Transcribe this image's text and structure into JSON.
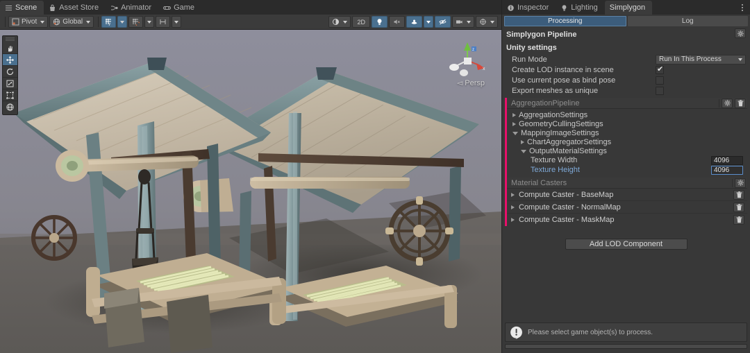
{
  "editor": {
    "scene_tabs": [
      {
        "label": "Scene",
        "icon": "scene-grid-icon",
        "active": true
      },
      {
        "label": "Asset Store",
        "icon": "store-bag-icon",
        "active": false
      },
      {
        "label": "Animator",
        "icon": "animator-node-icon",
        "active": false
      },
      {
        "label": "Game",
        "icon": "gamepad-icon",
        "active": false
      }
    ]
  },
  "scene_toolbar": {
    "pivot_label": "Pivot",
    "pivot_icon": "pivot-icon",
    "global_label": "Global",
    "global_icon": "globe-icon",
    "grid_snap_icon": "grid-snap-icon",
    "grid_snap_active": true,
    "snap_increment_icon": "snap-increment-icon",
    "view_grid_icon": "view-grid-icon",
    "shading_icon": "shading-mode-icon",
    "mode_2d_label": "2D",
    "lighting_icon": "lightbulb-icon",
    "lighting_active": true,
    "audio_icon": "audio-mute-icon",
    "effects_icon": "fx-toggle-icon",
    "effects_active": true,
    "visibility_icon": "scene-visibility-icon",
    "visibility_active": true,
    "camera_icon": "camera-icon",
    "gizmos_icon": "gizmos-icon"
  },
  "scene_tools": [
    {
      "name": "hand-tool",
      "icon": "hand-icon",
      "selected": false
    },
    {
      "name": "move-tool",
      "icon": "move-arrows-icon",
      "selected": true
    },
    {
      "name": "rotate-tool",
      "icon": "rotate-icon",
      "selected": false
    },
    {
      "name": "scale-tool",
      "icon": "scale-icon",
      "selected": false
    },
    {
      "name": "rect-tool",
      "icon": "rect-transform-icon",
      "selected": false
    },
    {
      "name": "transform-tool",
      "icon": "transform-icon",
      "selected": false
    }
  ],
  "scene_view": {
    "projection_label": "Persp",
    "gizmo_axis_x": "x",
    "gizmo_axis_y": "y",
    "gizmo_axis_z": "z",
    "sky_color": "#8b8b98",
    "ground_color": "#615e5c"
  },
  "inspector": {
    "tabs": [
      {
        "label": "Inspector",
        "icon": "info-circle-icon",
        "active": false
      },
      {
        "label": "Lighting",
        "icon": "lightbulb-icon",
        "active": false
      },
      {
        "label": "Simplygon",
        "icon": "",
        "active": true
      }
    ],
    "overflow_menu_icon": "kebab-menu-icon"
  },
  "simplygon": {
    "mode_tabs": [
      {
        "label": "Processing",
        "active": true
      },
      {
        "label": "Log",
        "active": false
      }
    ],
    "pipeline_header": "Simplygon Pipeline",
    "pipeline_header_gear_icon": "gear-icon",
    "unity_settings": {
      "title": "Unity settings",
      "fields": [
        {
          "label": "Run Mode",
          "type": "dropdown",
          "value": "Run In This Process"
        },
        {
          "label": "Create LOD instance in scene",
          "type": "checkbox",
          "checked": true
        },
        {
          "label": "Use current pose as bind pose",
          "type": "checkbox",
          "checked": false
        },
        {
          "label": "Export meshes as unique",
          "type": "checkbox",
          "checked": false
        }
      ]
    },
    "pipeline": {
      "name": "AggregationPipeline",
      "accent_color": "#e8106a",
      "gear_icon": "gear-icon",
      "trash_icon": "trash-icon",
      "tree": [
        {
          "label": "AggregationSettings",
          "indent": 0,
          "expanded": false,
          "selected": false
        },
        {
          "label": "GeometryCullingSettings",
          "indent": 0,
          "expanded": false,
          "selected": false
        },
        {
          "label": "MappingImageSettings",
          "indent": 0,
          "expanded": true,
          "selected": false
        },
        {
          "label": "ChartAggregatorSettings",
          "indent": 1,
          "expanded": false,
          "selected": false
        },
        {
          "label": "OutputMaterialSettings",
          "indent": 1,
          "expanded": true,
          "selected": false
        }
      ],
      "fields": [
        {
          "label": "Texture Width",
          "value": "4096",
          "focused": false
        },
        {
          "label": "Texture Height",
          "value": "4096",
          "focused": true
        }
      ]
    },
    "material_casters": {
      "header": "Material Casters",
      "gear_icon": "gear-icon",
      "items": [
        {
          "label": "Compute Caster - BaseMap",
          "trash_icon": "trash-icon"
        },
        {
          "label": "Compute Caster - NormalMap",
          "trash_icon": "trash-icon"
        },
        {
          "label": "Compute Caster - MaskMap",
          "trash_icon": "trash-icon"
        }
      ]
    },
    "add_lod_label": "Add LOD Component",
    "status": {
      "icon": "warning-speech-bubble-icon",
      "message": "Please select game object(s) to process."
    }
  }
}
